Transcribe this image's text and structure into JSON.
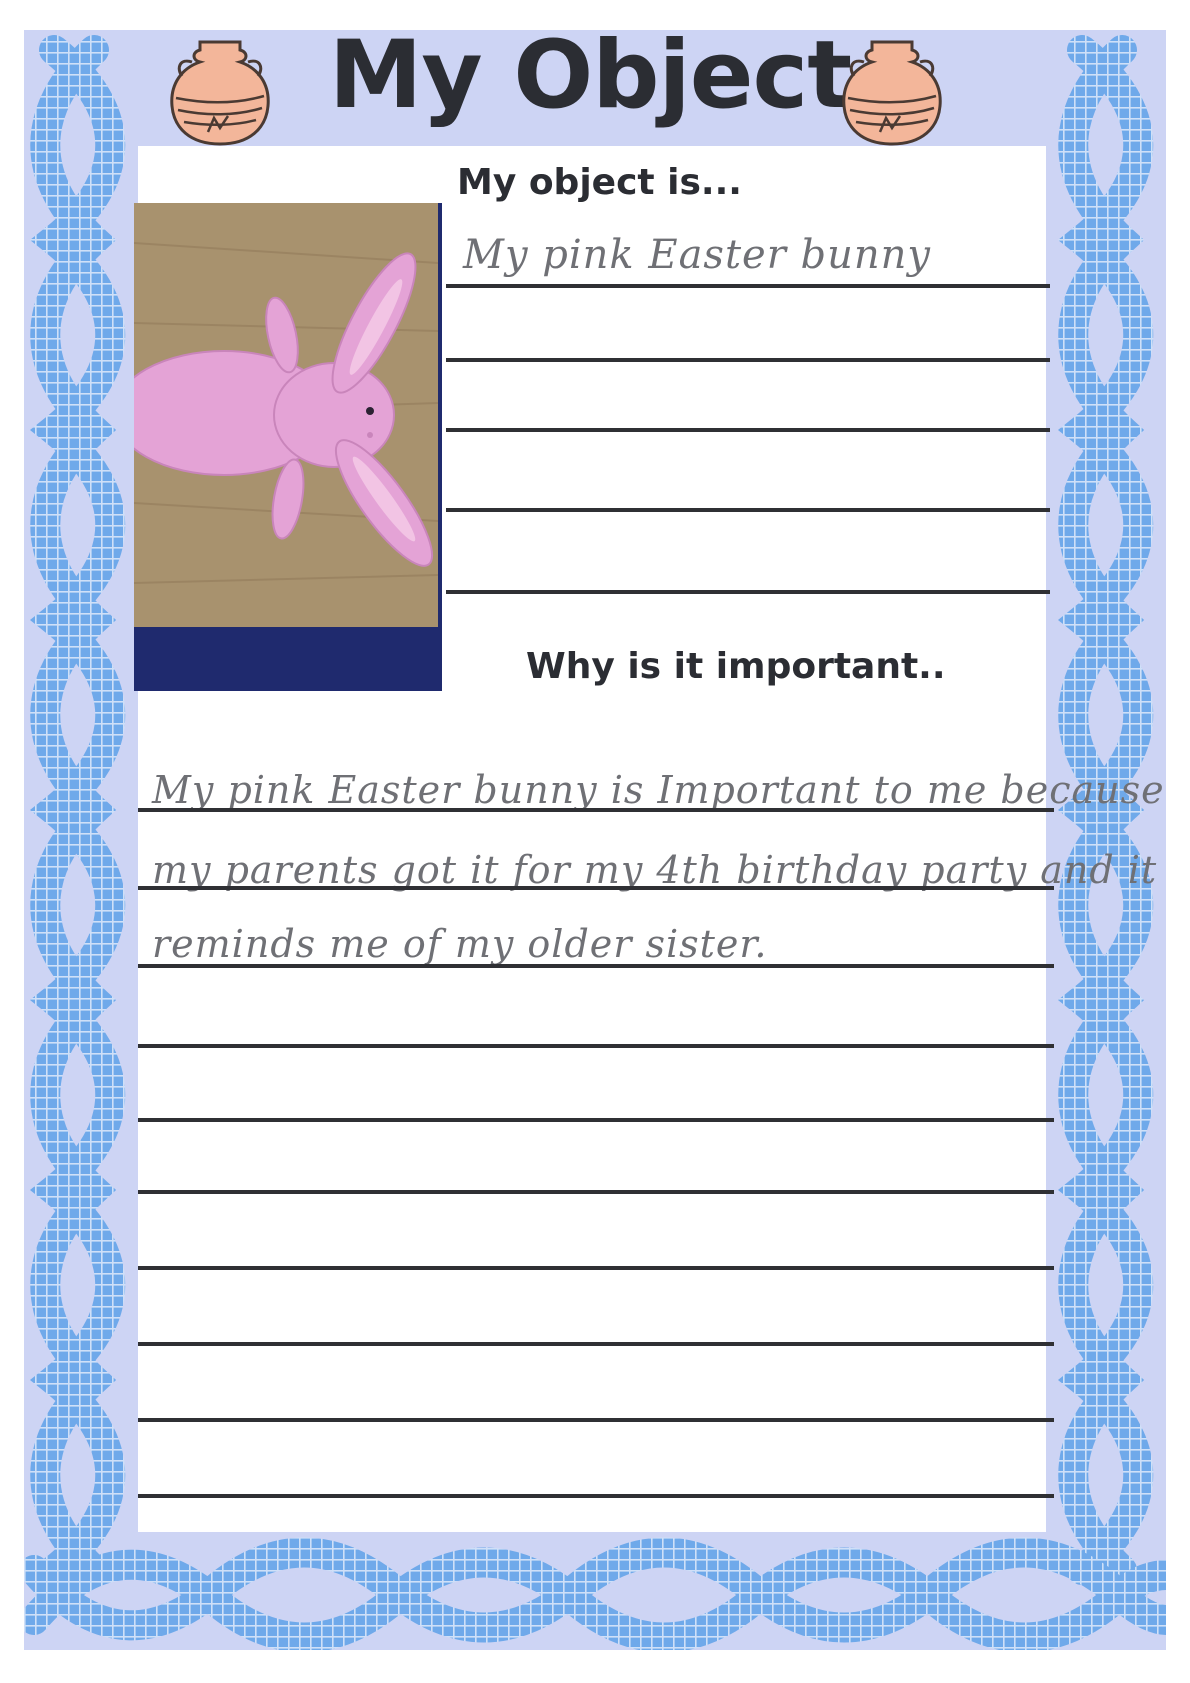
{
  "worksheet": {
    "title": "My Object",
    "section_object": {
      "heading": "My object is...",
      "answer": "My pink Easter bunny"
    },
    "section_importance": {
      "heading": "Why is it  important..",
      "answer_lines": [
        "My pink Easter bunny is Important to me because",
        "my parents got it for my 4th birthday party and it",
        "reminds me of my older sister."
      ]
    }
  },
  "colors": {
    "page_background": "#cdd4f4",
    "mosaic_blue": "#6fa9ea",
    "title_text": "#2b2d33",
    "pot_fill": "#f3b69a",
    "pencil": "#6f7075",
    "bunny_pink": "#e4a3d6"
  },
  "icons": [
    "roman-pot-icon",
    "roman-pot-icon"
  ]
}
